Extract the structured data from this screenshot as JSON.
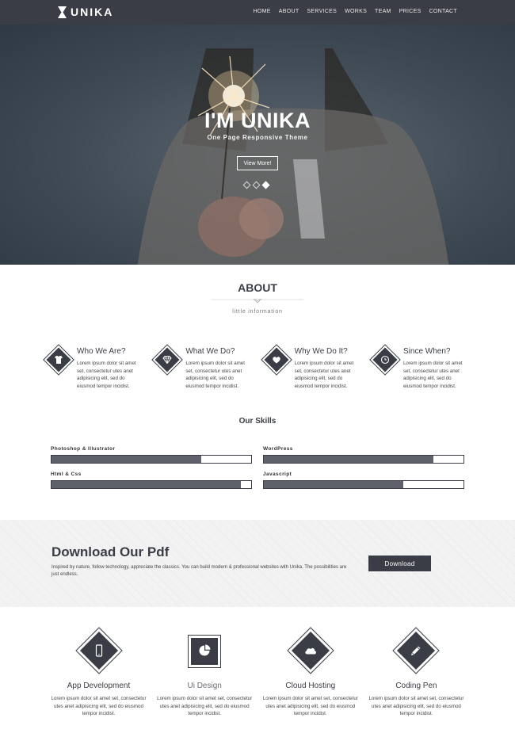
{
  "brand": {
    "logo_text": "UNIKA"
  },
  "nav": {
    "items": [
      "HOME",
      "ABOUT",
      "SERVICES",
      "WORKS",
      "TEAM",
      "PRICES",
      "CONTACT"
    ]
  },
  "hero": {
    "title": "I'M UNIKA",
    "subtitle": "One Page Responsive Theme",
    "button_label": "View More!",
    "slide_count": 3,
    "active_slide": 3
  },
  "about": {
    "title": "ABOUT",
    "subtitle": "little information",
    "features": [
      {
        "title": "Who We Are?",
        "text": "Lorem ipsum dolor sit amet set, consectetur utes anet adipisicing elit, sed do eiusmod tempor incidist.",
        "icon": "tshirt-icon"
      },
      {
        "title": "What We Do?",
        "text": "Lorem ipsum dolor sit amet set, consectetur utes anet adipisicing elit, sed do eiusmod tempor incidist.",
        "icon": "diamond-gem-icon"
      },
      {
        "title": "Why We Do It?",
        "text": "Lorem ipsum dolor sit amet set, consectetur utes anet adipisicing elit, sed do eiusmod tempor incidist.",
        "icon": "heart-icon"
      },
      {
        "title": "Since When?",
        "text": "Lorem ipsum dolor sit amet set, consectetur utes anet adipisicing elit, sed do eiusmod tempor incidist.",
        "icon": "clock-icon"
      }
    ]
  },
  "skills": {
    "title": "Our Skills",
    "items": [
      {
        "label": "Photoshop & Illustrator",
        "level_percent": 75
      },
      {
        "label": "WordPress",
        "level_percent": 85
      },
      {
        "label": "Html & Css",
        "level_percent": 95
      },
      {
        "label": "Javascript",
        "level_percent": 70
      }
    ]
  },
  "pdf": {
    "title": "Download Our Pdf",
    "text": "Inspired by nature, follow technology, appreciate the classics. You can build modern & professional websites with Unika. The possibilities are just endless.",
    "button_label": "Download"
  },
  "services": {
    "items": [
      {
        "title": "App Development",
        "text": "Lorem ipsum dolor sit amet set, consectetur utes anet adipisicing elit, sed do eiusmod tempor incidist.",
        "icon": "mobile-icon"
      },
      {
        "title": "Ui Design",
        "text": "Lorem ipsum dolor sit amet set, consectetur utes anet adipisicing elit, sed do eiusmod tempor incidist.",
        "icon": "pie-chart-icon"
      },
      {
        "title": "Cloud Hosting",
        "text": "Lorem ipsum dolor sit amet set, consectetur utes anet adipisicing elit, sed do eiusmod tempor incidist.",
        "icon": "cloud-icon"
      },
      {
        "title": "Coding Pen",
        "text": "Lorem ipsum dolor sit amet set, consectetur utes anet adipisicing elit, sed do eiusmod tempor incidist.",
        "icon": "pencil-icon"
      }
    ]
  },
  "colors": {
    "dark": "#3a3d45",
    "bar_fill": "#5e616a",
    "pdf_bg": "#f2f2f2"
  }
}
